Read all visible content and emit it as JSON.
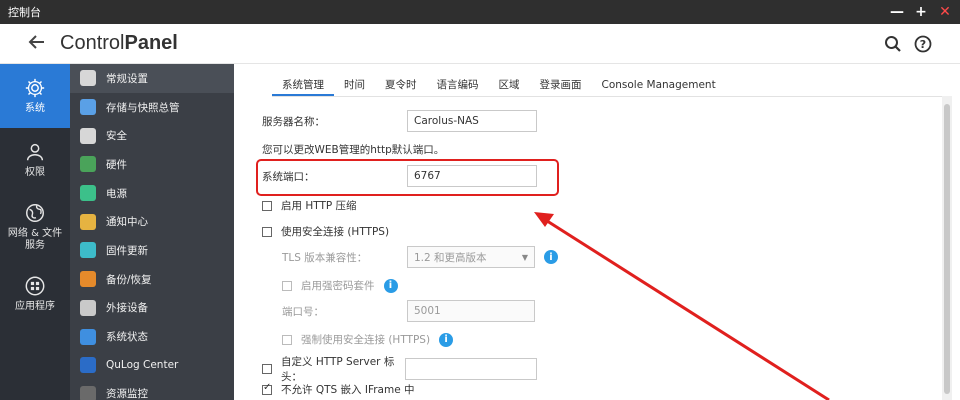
{
  "window": {
    "title": "控制台",
    "minimize": "—",
    "maximize": "+",
    "close": "✕"
  },
  "header": {
    "title_light": "Control",
    "title_bold": "Panel"
  },
  "leftnav": [
    {
      "label": "系统",
      "icon": "gear-icon",
      "active": true
    },
    {
      "label": "权限",
      "icon": "user-icon"
    },
    {
      "label": "网络 & 文件\n服务",
      "icon": "globe-icon"
    },
    {
      "label": "应用程序",
      "icon": "apps-icon"
    }
  ],
  "subnav": [
    {
      "label": "常规设置",
      "icon": "general-settings-icon",
      "color": "#d7d7d7"
    },
    {
      "label": "存储与快照总管",
      "icon": "storage-icon",
      "color": "#5aa0e6"
    },
    {
      "label": "安全",
      "icon": "lock-icon",
      "color": "#d7d7d7"
    },
    {
      "label": "硬件",
      "icon": "hardware-icon",
      "color": "#4aa35a"
    },
    {
      "label": "电源",
      "icon": "power-icon",
      "color": "#3cc08a"
    },
    {
      "label": "通知中心",
      "icon": "notification-icon",
      "color": "#e6b341"
    },
    {
      "label": "固件更新",
      "icon": "firmware-icon",
      "color": "#3dbbc9"
    },
    {
      "label": "备份/恢复",
      "icon": "backup-icon",
      "color": "#e58a2b"
    },
    {
      "label": "外接设备",
      "icon": "external-device-icon",
      "color": "#c9c9c9"
    },
    {
      "label": "系统状态",
      "icon": "system-status-icon",
      "color": "#3f8fe0"
    },
    {
      "label": "QuLog Center",
      "icon": "qulog-icon",
      "color": "#2b6cc7"
    },
    {
      "label": "资源监控",
      "icon": "resource-monitor-icon",
      "color": "#6a6a6a"
    }
  ],
  "tabs": [
    "系统管理",
    "时间",
    "夏令时",
    "语言编码",
    "区域",
    "登录画面",
    "Console Management"
  ],
  "form": {
    "server_name_label": "服务器名称：",
    "server_name_value": "Carolus-NAS",
    "port_hint": "您可以更改WEB管理的http默认端口。",
    "system_port_label": "系统端口：",
    "system_port_value": "6767",
    "http_compress_label": "启用 HTTP 压缩",
    "https_label": "使用安全连接 (HTTPS)",
    "tls_label": "TLS 版本兼容性：",
    "tls_value": "1.2 和更高版本",
    "strong_cipher_label": "启用强密码套件",
    "https_port_label": "端口号：",
    "https_port_value": "5001",
    "force_https_label": "强制使用安全连接 (HTTPS)",
    "custom_header_label": "自定义 HTTP Server 标头：",
    "iframe_label": "不允许 QTS 嵌入 IFrame 中"
  },
  "colors": {
    "accent": "#2a7ad6",
    "highlight": "#e0201e",
    "info": "#2a9ce6"
  }
}
